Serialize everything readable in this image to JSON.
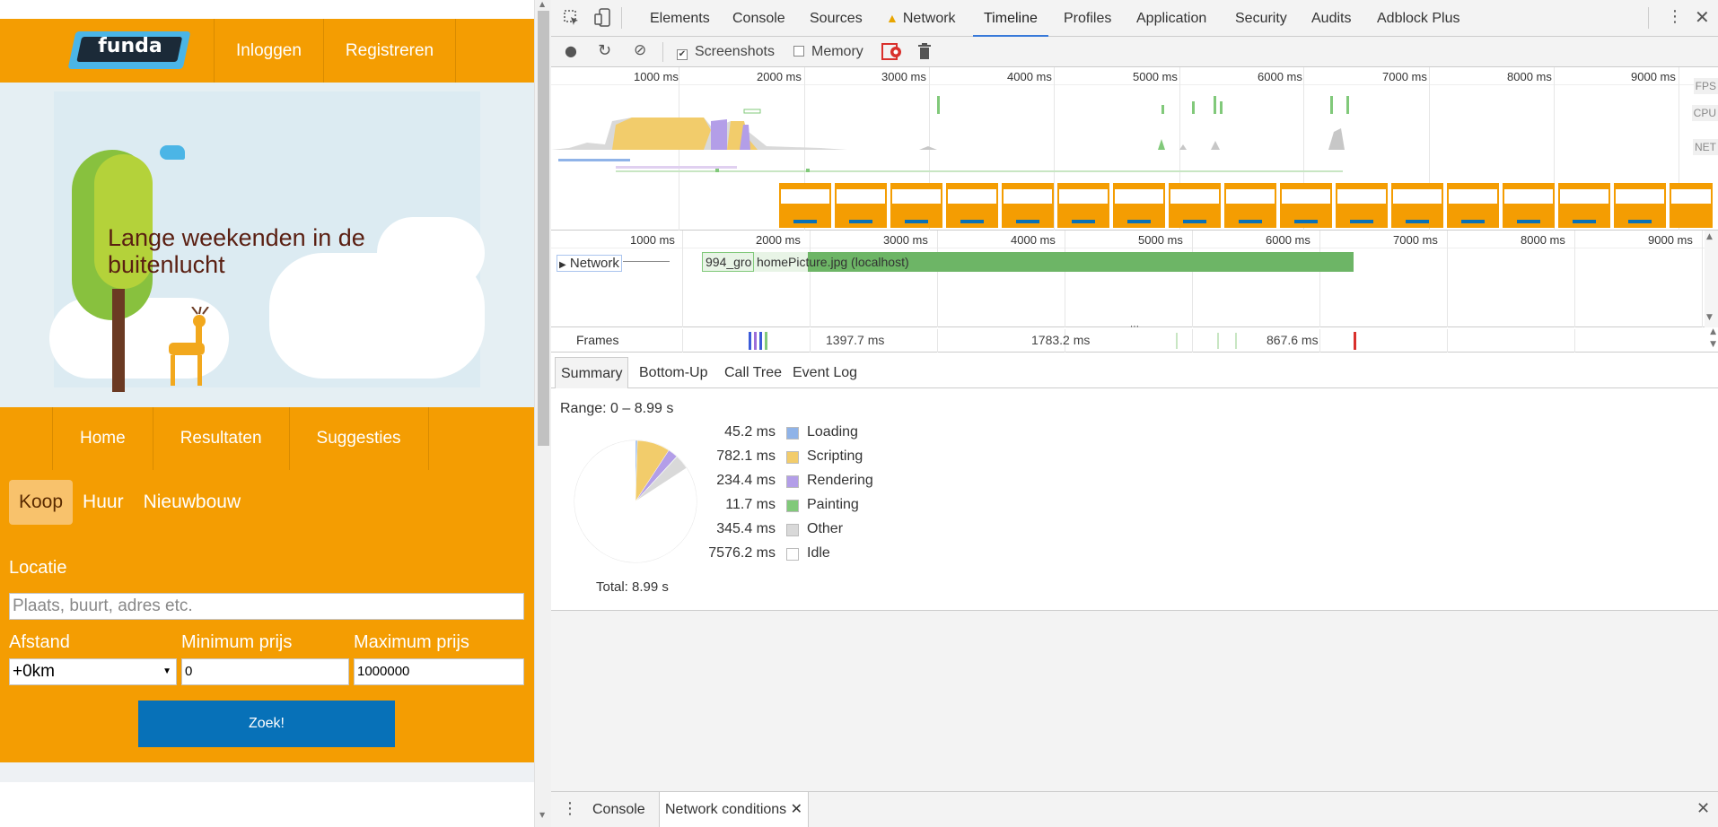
{
  "page": {
    "logo_text": "funda",
    "topnav": [
      {
        "label": "Inloggen"
      },
      {
        "label": "Registreren"
      }
    ],
    "hero_title": "Lange weekenden in de buitenlucht",
    "subnav": [
      {
        "label": "Home"
      },
      {
        "label": "Resultaten"
      },
      {
        "label": "Suggesties"
      }
    ],
    "type_tabs": [
      {
        "label": "Koop",
        "active": true
      },
      {
        "label": "Huur",
        "active": false
      },
      {
        "label": "Nieuwbouw",
        "active": false
      }
    ],
    "location_label": "Locatie",
    "location_placeholder": "Plaats, buurt, adres etc.",
    "distance_label": "Afstand",
    "distance_value": "+0km",
    "min_price_label": "Minimum prijs",
    "min_price_value": "0",
    "max_price_label": "Maximum prijs",
    "max_price_value": "1000000",
    "search_button": "Zoek!",
    "colors": {
      "brand": "#f49d02",
      "button": "#0771b8",
      "logo_accent": "#4bb5e6"
    }
  },
  "devtools": {
    "tabs": [
      {
        "label": "Elements"
      },
      {
        "label": "Console"
      },
      {
        "label": "Sources"
      },
      {
        "label": "Network",
        "warning": true
      },
      {
        "label": "Timeline",
        "active": true
      },
      {
        "label": "Profiles"
      },
      {
        "label": "Application"
      },
      {
        "label": "Security"
      },
      {
        "label": "Audits"
      },
      {
        "label": "Adblock Plus"
      }
    ],
    "toolbar": {
      "screenshots_label": "Screenshots",
      "screenshots_checked": true,
      "memory_label": "Memory",
      "memory_checked": false
    },
    "ruler": [
      "1000 ms",
      "2000 ms",
      "3000 ms",
      "4000 ms",
      "5000 ms",
      "6000 ms",
      "7000 ms",
      "8000 ms",
      "9000 ms"
    ],
    "overview_labels": {
      "fps": "FPS",
      "cpu": "CPU",
      "net": "NET"
    },
    "flame": {
      "track_label": "Network",
      "request1": "994_gro",
      "request2": "homePicture.jpg (localhost)"
    },
    "frames": {
      "label": "Frames",
      "durations": [
        "1397.7 ms",
        "1783.2 ms",
        "867.6 ms"
      ]
    },
    "summary_tabs": [
      {
        "label": "Summary",
        "active": true
      },
      {
        "label": "Bottom-Up"
      },
      {
        "label": "Call Tree"
      },
      {
        "label": "Event Log"
      }
    ],
    "range": "Range: 0 – 8.99 s",
    "total": "Total: 8.99 s",
    "drawer_tabs": [
      {
        "label": "Console"
      },
      {
        "label": "Network conditions",
        "active": true
      }
    ]
  },
  "chart_data": {
    "type": "pie",
    "title": "",
    "categories": [
      "Loading",
      "Scripting",
      "Rendering",
      "Painting",
      "Other",
      "Idle"
    ],
    "values": [
      45.2,
      782.1,
      234.4,
      11.7,
      345.4,
      7576.2
    ],
    "labels": [
      "45.2 ms",
      "782.1 ms",
      "234.4 ms",
      "11.7 ms",
      "345.4 ms",
      "7576.2 ms"
    ],
    "colors": [
      "#8fb3e8",
      "#f2cc6b",
      "#b39ee8",
      "#81c97a",
      "#d9d9d9",
      "#ffffff"
    ],
    "legend": "right"
  }
}
